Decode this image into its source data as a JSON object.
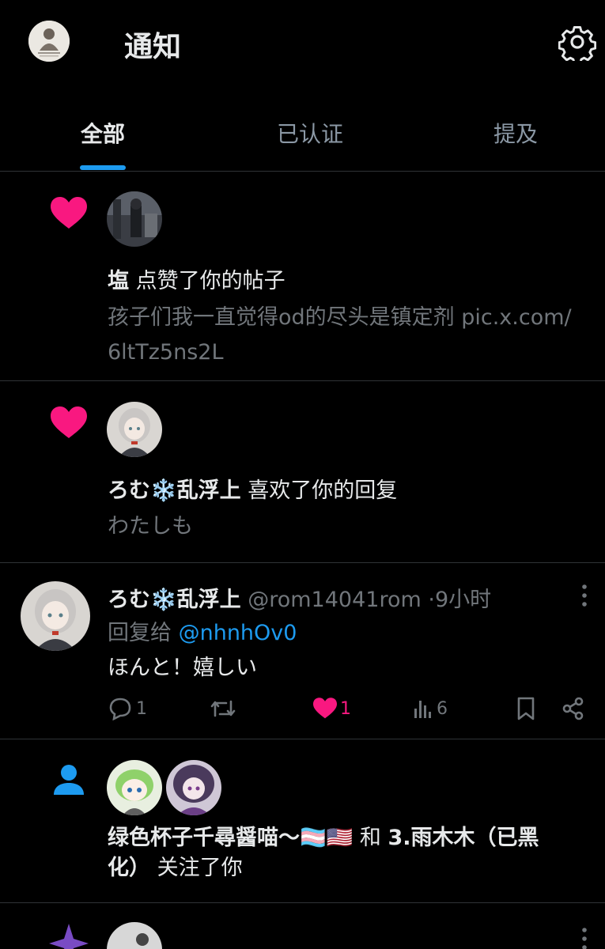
{
  "header": {
    "title": "通知",
    "avatar_icon": "profile-avatar",
    "settings_icon": "gear-icon"
  },
  "tabs": [
    {
      "label": "全部",
      "active": true
    },
    {
      "label": "已认证",
      "active": false
    },
    {
      "label": "提及",
      "active": false
    }
  ],
  "notifications": [
    {
      "type": "like",
      "icon": "heart-icon",
      "user": "塩",
      "action": "点赞了你的帖子",
      "content_line1": "孩子们我一直觉得od的尽头是镇定剂 pic.x.com/",
      "content_line2": "6ltTz5ns2L"
    },
    {
      "type": "like",
      "icon": "heart-icon",
      "user": "ろむ❄️乱浮上",
      "action": "喜欢了你的回复",
      "content": "わたしも"
    }
  ],
  "reply": {
    "user": "ろむ❄️乱浮上",
    "handle": "@rom14041rom",
    "time": "9小时",
    "reply_to_label": "回复给",
    "reply_to_handle": "@nhnhOv0",
    "text": "ほんと！嬉しい",
    "stats": {
      "replies": "1",
      "likes": "1",
      "views": "6"
    }
  },
  "follow": {
    "icon": "person-icon",
    "user1": "绿色杯子千尋醤喵～🏳️‍⚧️🇺🇸",
    "joiner": "和",
    "user2_line1": "3.雨木木（已黑",
    "user2_line2": "化）",
    "action": "关注了你"
  },
  "colors": {
    "background": "#000000",
    "accent": "#1d9bf0",
    "like": "#f91880",
    "muted": "#71767b",
    "divider": "#2f3336",
    "star": "#794bc4"
  }
}
